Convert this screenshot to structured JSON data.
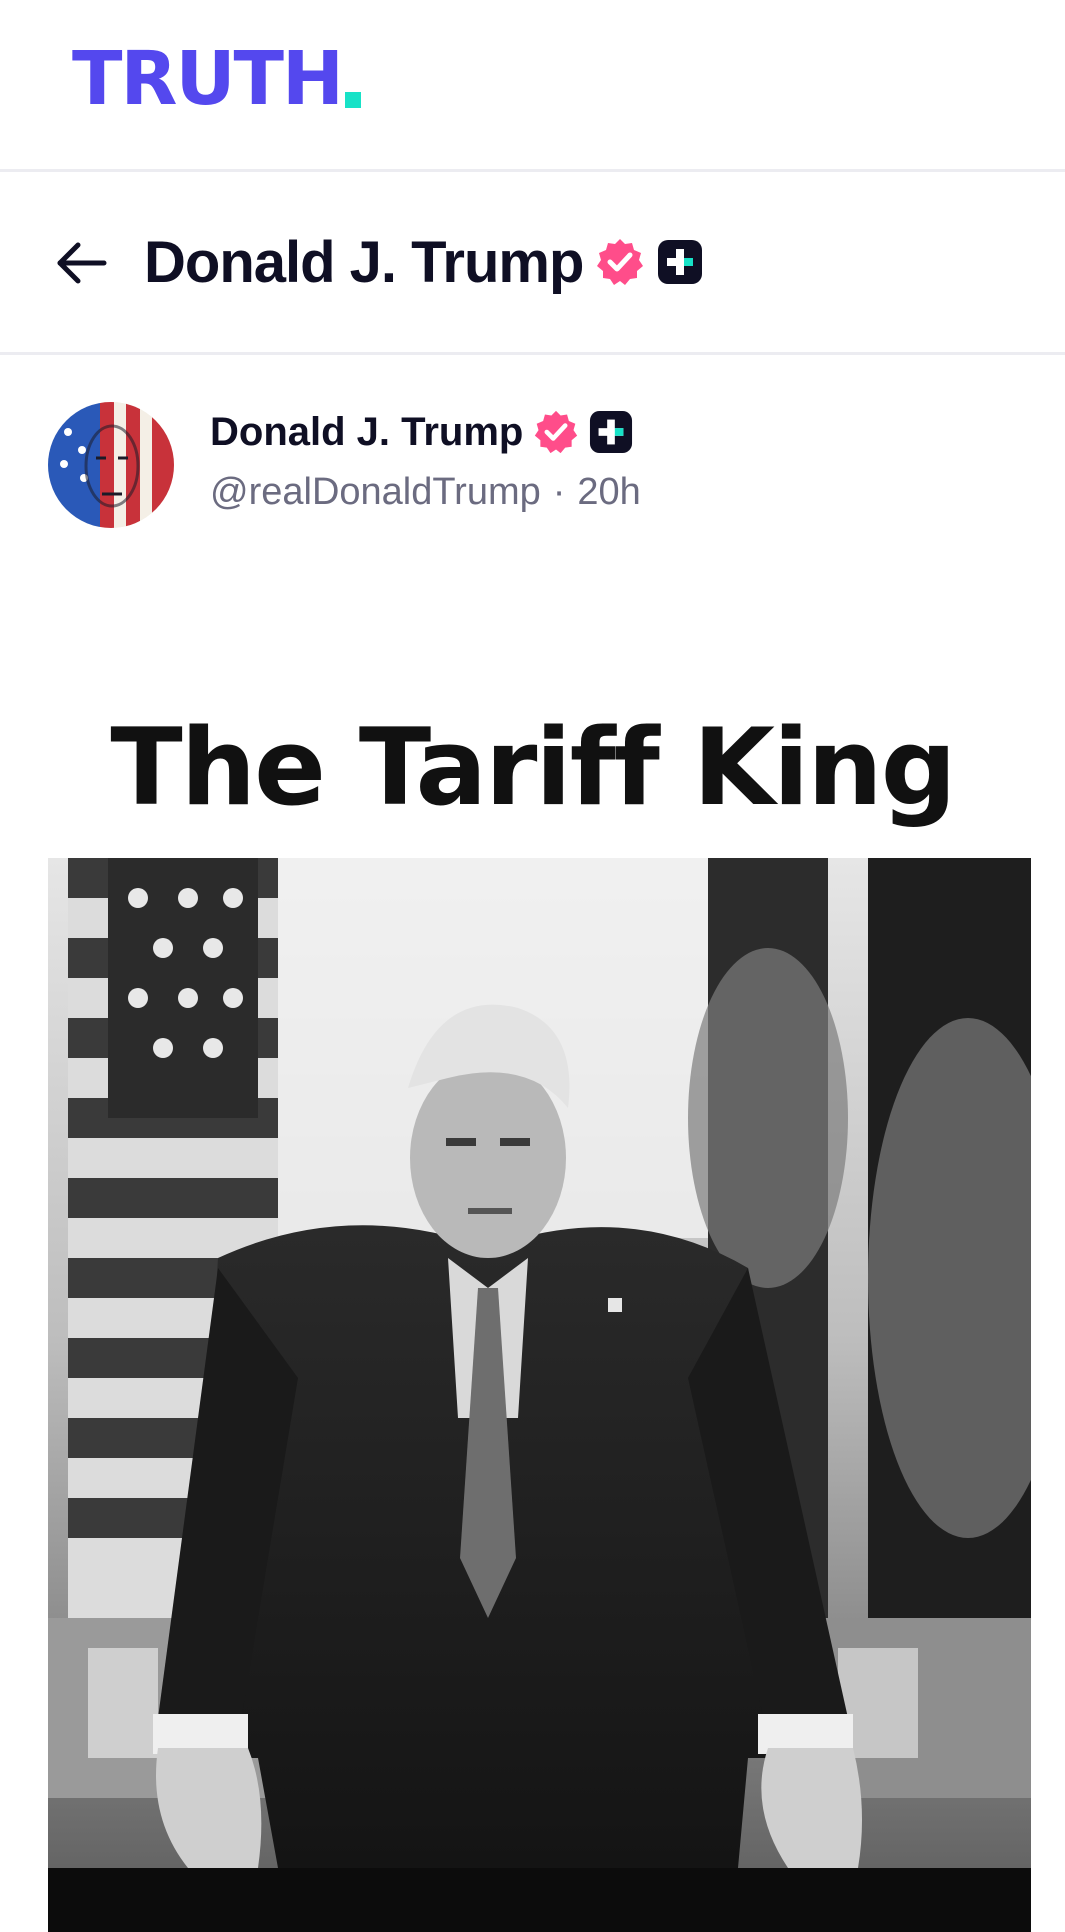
{
  "brand": {
    "logo_text": "TRUTH",
    "primary_color": "#5448ee",
    "accent_color": "#17e2c7"
  },
  "header": {
    "back_icon": "arrow-left-icon",
    "title": "Donald J. Trump",
    "badges": [
      "verified-badge-icon",
      "truth-plus-icon"
    ]
  },
  "post": {
    "author_name": "Donald J. Trump",
    "handle": "@realDonaldTrump",
    "separator": "·",
    "age": "20h",
    "image_title": "The Tariff King"
  },
  "colors": {
    "verified": "#ff4d8a",
    "plus_badge": "#0f0f24",
    "text_primary": "#0f0f24",
    "text_secondary": "#6b6b80"
  }
}
